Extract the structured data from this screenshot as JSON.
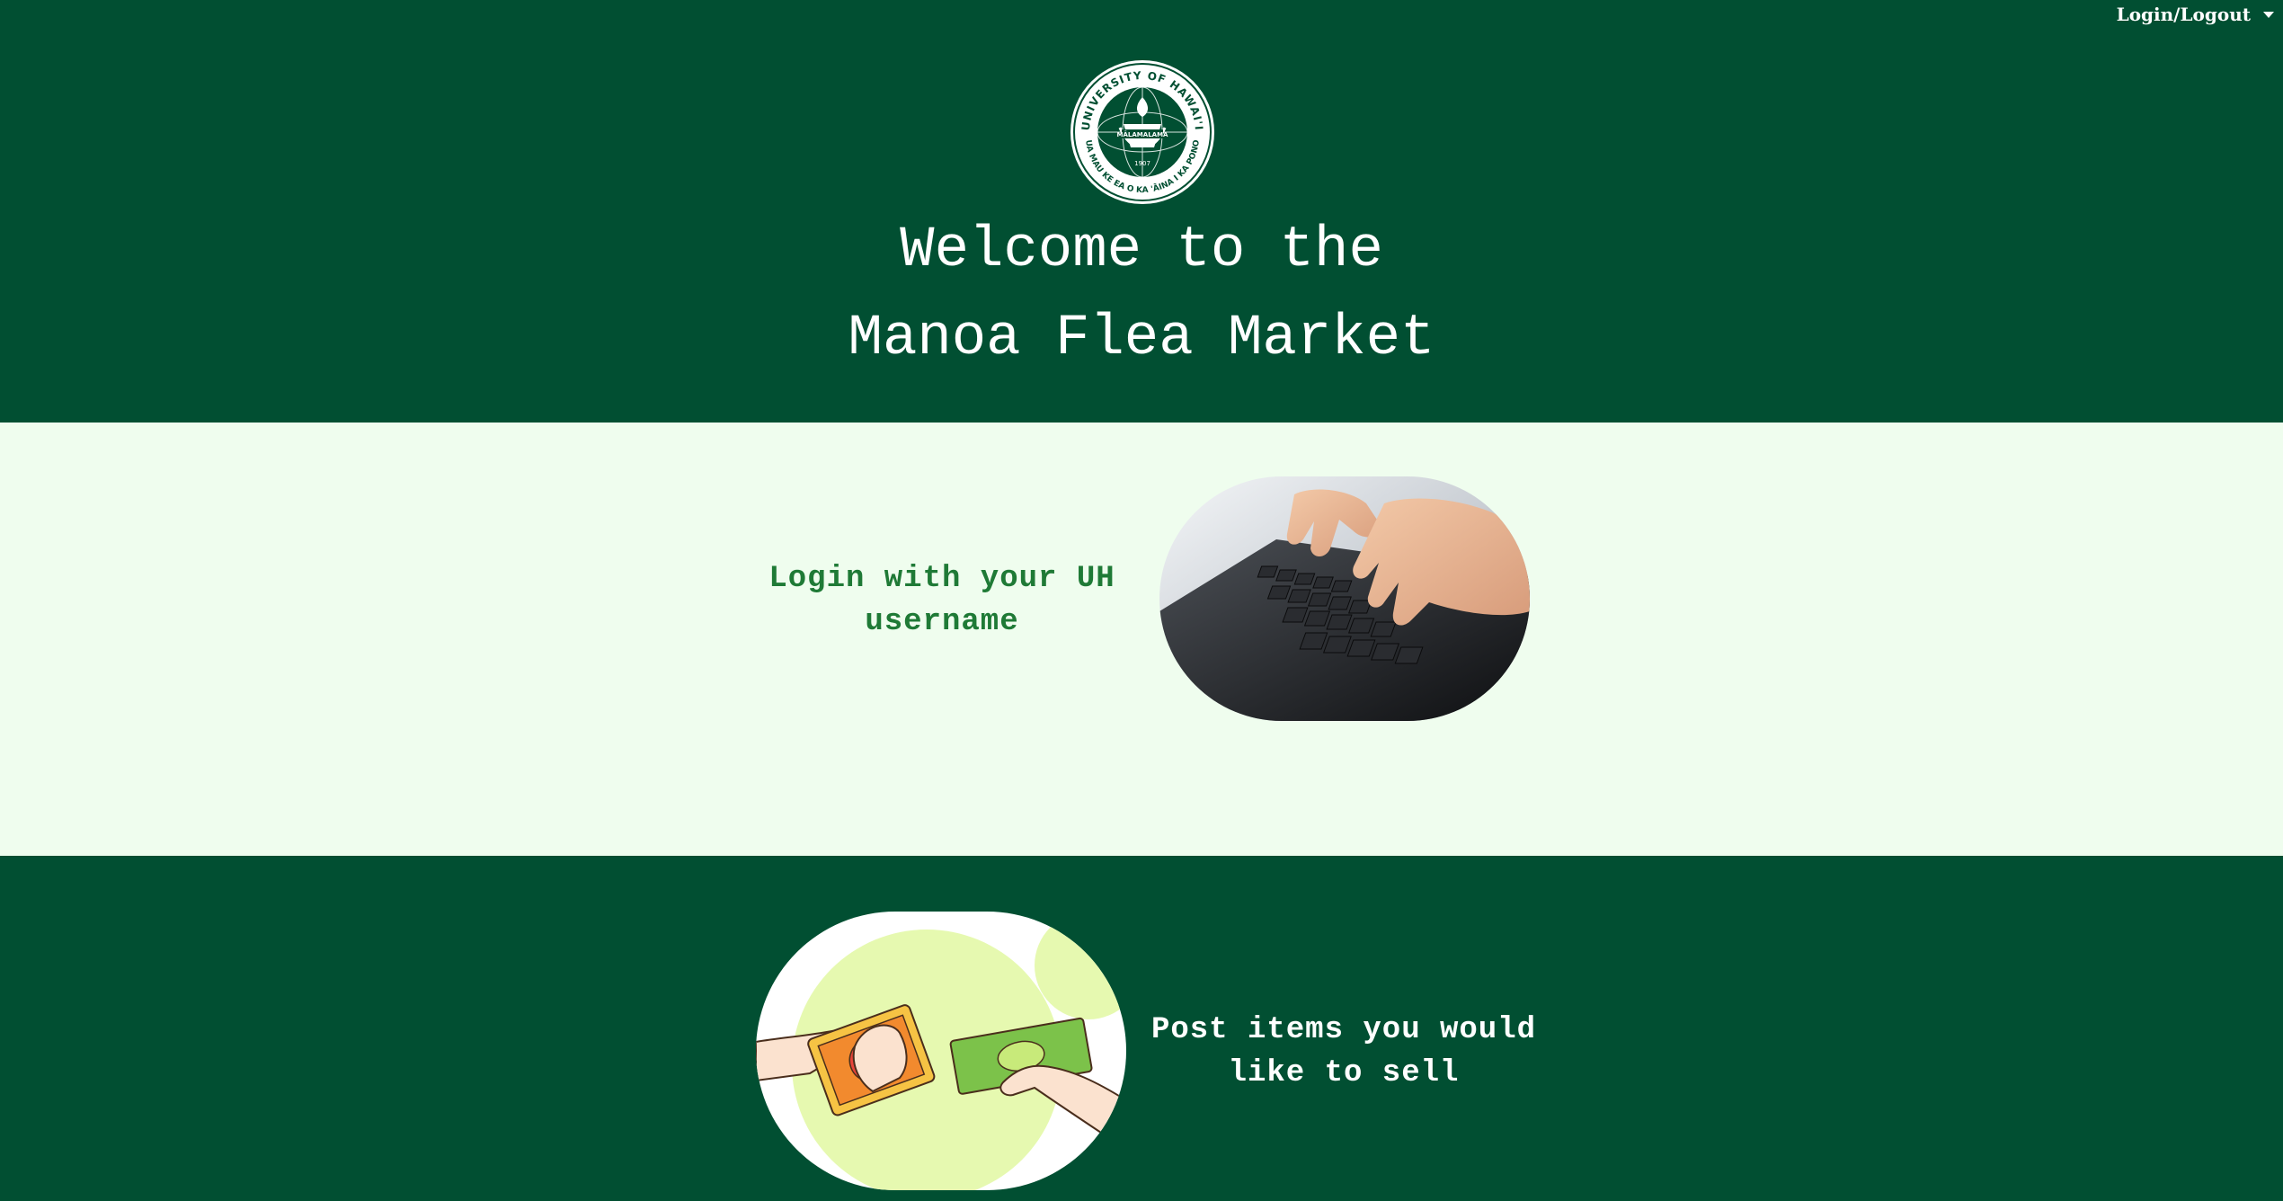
{
  "nav": {
    "login_label": "Login/Logout"
  },
  "hero": {
    "title_line1": "Welcome to the",
    "title_line2": "Manoa Flea Market",
    "seal_text_top": "UNIVERSITY OF HAWAI'I",
    "seal_text_bottom": "UA MAU KE EA O KA 'ĀINA I KA PONO",
    "seal_banner": "MĀLAMALAMA",
    "seal_year": "1907"
  },
  "sections": {
    "login_text": "Login with your UH username",
    "post_text": "Post items you would like to sell"
  },
  "colors": {
    "primary_green": "#014f32",
    "light_mint": "#effdee",
    "text_green": "#1f7a36"
  },
  "icons": [
    "dropdown-caret-icon",
    "university-seal-logo",
    "keyboard-typing-photo",
    "money-exchange-illustration"
  ]
}
